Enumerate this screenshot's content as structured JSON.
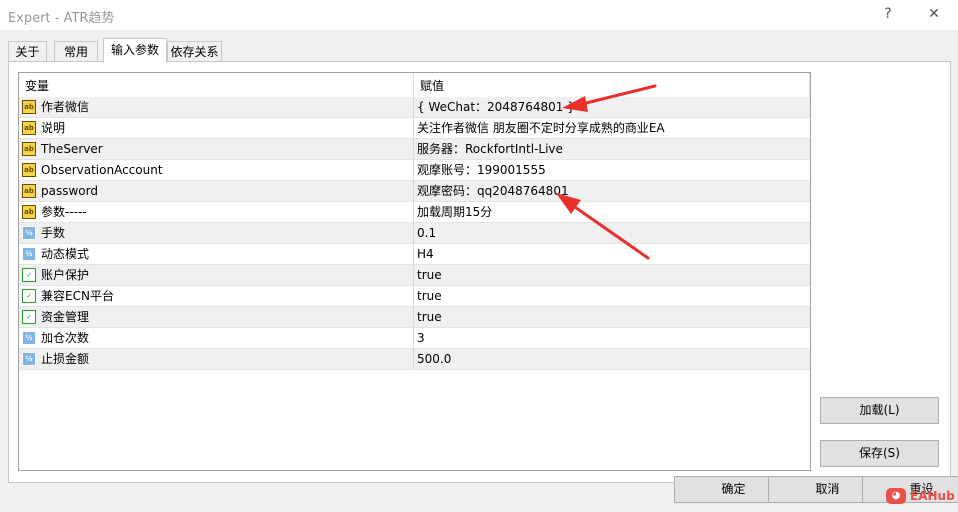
{
  "window": {
    "title": "Expert - ATR趋势",
    "help_glyph": "?",
    "close_glyph": "✕"
  },
  "tabs": [
    {
      "label": "关于"
    },
    {
      "label": "常用"
    },
    {
      "label": "输入参数"
    },
    {
      "label": "依存关系"
    }
  ],
  "grid": {
    "columns": {
      "variable": "变量",
      "value": "赋值"
    },
    "rows": [
      {
        "icon": "ab",
        "icon_name": "string-icon",
        "name": "作者微信",
        "value": "{ WeChat：2048764801 }"
      },
      {
        "icon": "ab",
        "icon_name": "string-icon",
        "name": "说明",
        "value": "关注作者微信 朋友圈不定时分享成熟的商业EA"
      },
      {
        "icon": "ab",
        "icon_name": "string-icon",
        "name": "TheServer",
        "value": "服务器：RockfortIntl-Live"
      },
      {
        "icon": "ab",
        "icon_name": "string-icon",
        "name": "ObservationAccount",
        "value": "观摩账号：199001555"
      },
      {
        "icon": "ab",
        "icon_name": "string-icon",
        "name": "password",
        "value": "观摩密码：qq2048764801"
      },
      {
        "icon": "ab",
        "icon_name": "string-icon",
        "name": "参数-----",
        "value": "加载周期15分"
      },
      {
        "icon": "num",
        "icon_name": "double-icon",
        "name": "手数",
        "value": "0.1"
      },
      {
        "icon": "num",
        "icon_name": "integer-icon",
        "name": "动态模式",
        "value": "H4"
      },
      {
        "icon": "bool",
        "icon_name": "bool-icon",
        "name": "账户保护",
        "value": "true"
      },
      {
        "icon": "bool",
        "icon_name": "bool-icon",
        "name": "兼容ECN平台",
        "value": "true"
      },
      {
        "icon": "bool",
        "icon_name": "bool-icon",
        "name": "资金管理",
        "value": "true"
      },
      {
        "icon": "num",
        "icon_name": "integer-icon",
        "name": "加仓次数",
        "value": "3"
      },
      {
        "icon": "num",
        "icon_name": "double-icon",
        "name": "止损金额",
        "value": "500.0"
      }
    ]
  },
  "buttons": {
    "load": "加载(L)",
    "save": "保存(S)",
    "ok": "确定",
    "cancel": "取消",
    "reset": "重设"
  },
  "watermark": {
    "text": "EAHub"
  },
  "colors": {
    "annotation_arrow": "#e8312a",
    "active_tab": "#ffffff"
  }
}
